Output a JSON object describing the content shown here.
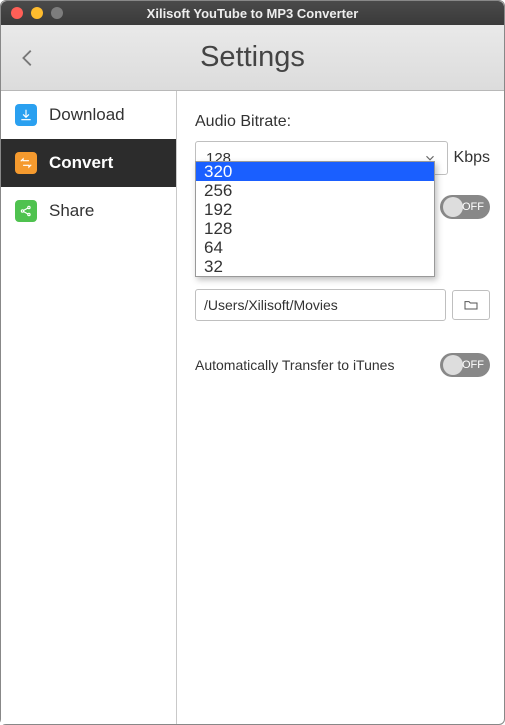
{
  "window": {
    "title": "Xilisoft YouTube to MP3 Converter"
  },
  "header": {
    "title": "Settings"
  },
  "sidebar": {
    "items": [
      {
        "label": "Download"
      },
      {
        "label": "Convert"
      },
      {
        "label": "Share"
      }
    ]
  },
  "content": {
    "bitrate_label": "Audio Bitrate:",
    "bitrate_selected": "128",
    "bitrate_unit": "Kbps",
    "bitrate_options": [
      "320",
      "256",
      "192",
      "128",
      "64",
      "32"
    ],
    "toggle1_state": "OFF",
    "destination_label_fragment": "/Users/Xilisoft/Movies",
    "destination_value": "/Users/Xilisoft/Movies",
    "itunes_label": "Automatically Transfer to iTunes",
    "itunes_state": "OFF"
  }
}
